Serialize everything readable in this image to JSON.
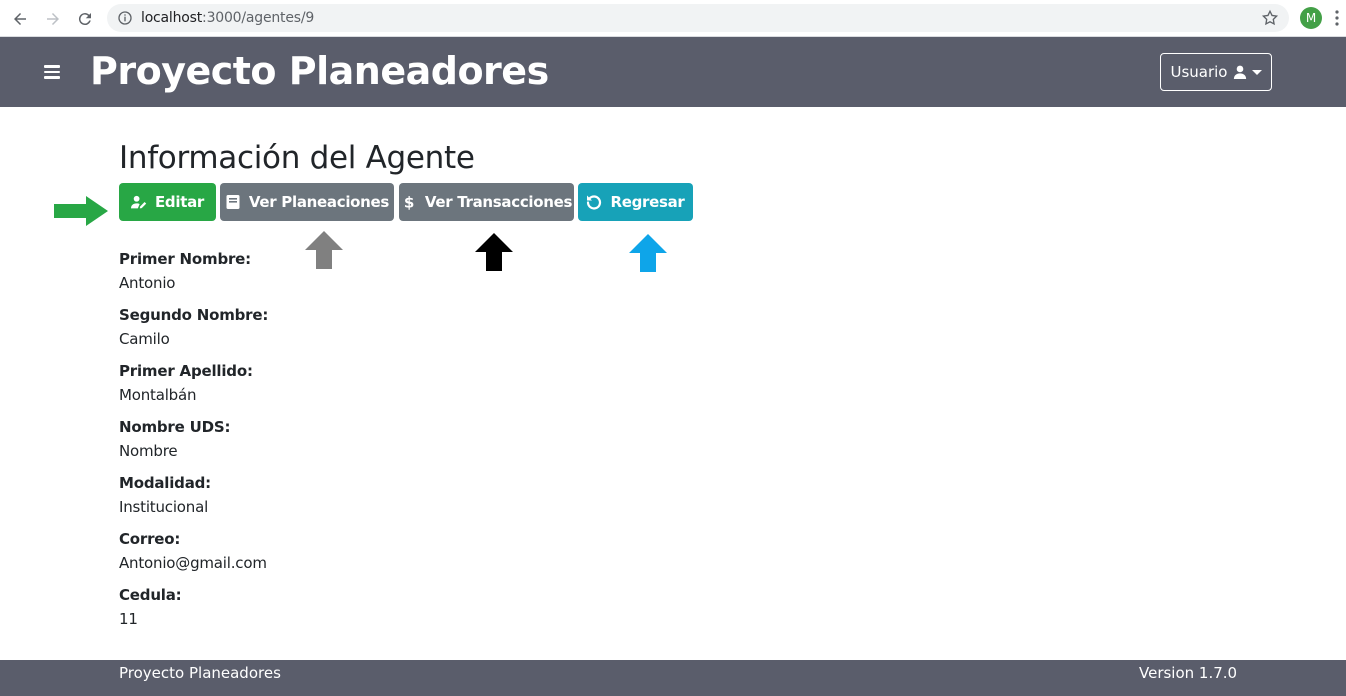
{
  "browser": {
    "url_host": "localhost",
    "url_path": ":3000/agentes/9",
    "profile_initial": "M"
  },
  "header": {
    "app_title": "Proyecto Planeadores",
    "user_menu_label": "Usuario"
  },
  "main": {
    "page_title": "Información del Agente",
    "buttons": {
      "edit": "Editar",
      "plans": "Ver Planeaciones",
      "transactions": "Ver Transacciones",
      "back": "Regresar"
    },
    "fields": [
      {
        "label": "Primer Nombre:",
        "value": "Antonio"
      },
      {
        "label": "Segundo Nombre:",
        "value": "Camilo"
      },
      {
        "label": "Primer Apellido:",
        "value": "Montalbán"
      },
      {
        "label": "Nombre UDS:",
        "value": "Nombre"
      },
      {
        "label": "Modalidad:",
        "value": "Institucional"
      },
      {
        "label": "Correo:",
        "value": "Antonio@gmail.com"
      },
      {
        "label": "Cedula:",
        "value": "11"
      }
    ]
  },
  "footer": {
    "app_name": "Proyecto Planeadores",
    "version": "Version 1.7.0"
  },
  "colors": {
    "header_bg": "#5a5d6b",
    "edit_button": "#28a745",
    "secondary_button": "#6c757d",
    "back_button": "#17a2b8",
    "arrow_green": "#28a745",
    "arrow_gray": "#808080",
    "arrow_black": "#000000",
    "arrow_blue": "#0ea5e9"
  },
  "icons": {
    "edit": "user-edit-icon",
    "plans": "book-icon",
    "transactions": "dollar-icon",
    "back": "undo-icon",
    "user": "user-icon"
  }
}
